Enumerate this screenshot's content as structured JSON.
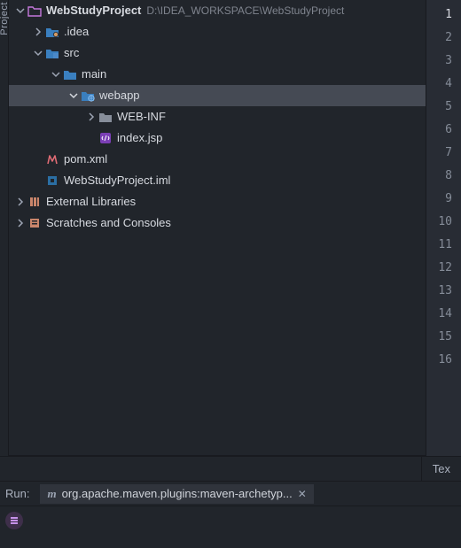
{
  "leftStrip": {
    "label": "Project"
  },
  "tree": {
    "root": {
      "name": "WebStudyProject",
      "path": "D:\\IDEA_WORKSPACE\\WebStudyProject"
    },
    "idea": {
      "name": ".idea"
    },
    "src": {
      "name": "src"
    },
    "main": {
      "name": "main"
    },
    "webapp": {
      "name": "webapp"
    },
    "webinf": {
      "name": "WEB-INF"
    },
    "indexjsp": {
      "name": "index.jsp"
    },
    "pom": {
      "name": "pom.xml"
    },
    "iml": {
      "name": "WebStudyProject.iml"
    },
    "extlib": {
      "name": "External Libraries"
    },
    "scratches": {
      "name": "Scratches and Consoles"
    }
  },
  "gutter": {
    "lines": [
      "1",
      "2",
      "3",
      "4",
      "5",
      "6",
      "7",
      "8",
      "9",
      "10",
      "11",
      "12",
      "13",
      "14",
      "15",
      "16"
    ],
    "current": 1
  },
  "rightTab": {
    "label": "Tex"
  },
  "run": {
    "label": "Run:",
    "tab": "org.apache.maven.plugins:maven-archetyp..."
  }
}
